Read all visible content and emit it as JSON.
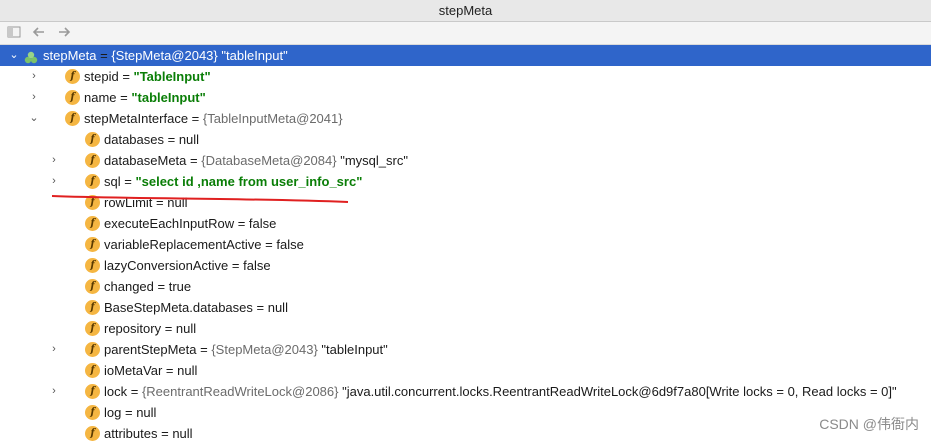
{
  "window": {
    "title": "stepMeta"
  },
  "tree": [
    {
      "arrow": "⌄",
      "icon": "obj",
      "name": "stepMeta",
      "type": "{StepMeta@2043}",
      "value": "\"tableInput\"",
      "value_style": "plain",
      "selected": true
    },
    {
      "arrow": "›",
      "icon": "f",
      "name": "stepid",
      "type": "",
      "value": "\"TableInput\"",
      "value_style": "str"
    },
    {
      "arrow": "›",
      "icon": "f",
      "name": "name",
      "type": "",
      "value": "\"tableInput\"",
      "value_style": "str"
    },
    {
      "arrow": "⌄",
      "icon": "f",
      "name": "stepMetaInterface",
      "type": "{TableInputMeta@2041}",
      "value": "",
      "value_style": "plain"
    },
    {
      "arrow": "",
      "icon": "f",
      "name": "databases",
      "type": "",
      "value": "null",
      "value_style": "plain"
    },
    {
      "arrow": "›",
      "icon": "f",
      "name": "databaseMeta",
      "type": "{DatabaseMeta@2084}",
      "value": "\"mysql_src\"",
      "value_style": "plain"
    },
    {
      "arrow": "›",
      "icon": "f",
      "name": "sql",
      "type": "",
      "value": "\"select id ,name from user_info_src\"",
      "value_style": "str"
    },
    {
      "arrow": "",
      "icon": "f",
      "name": "rowLimit",
      "type": "",
      "value": "null",
      "value_style": "plain"
    },
    {
      "arrow": "",
      "icon": "f",
      "name": "executeEachInputRow",
      "type": "",
      "value": "false",
      "value_style": "plain"
    },
    {
      "arrow": "",
      "icon": "f",
      "name": "variableReplacementActive",
      "type": "",
      "value": "false",
      "value_style": "plain"
    },
    {
      "arrow": "",
      "icon": "f",
      "name": "lazyConversionActive",
      "type": "",
      "value": "false",
      "value_style": "plain"
    },
    {
      "arrow": "",
      "icon": "f",
      "name": "changed",
      "type": "",
      "value": "true",
      "value_style": "plain"
    },
    {
      "arrow": "",
      "icon": "f",
      "name": "BaseStepMeta.databases",
      "type": "",
      "value": "null",
      "value_style": "plain"
    },
    {
      "arrow": "",
      "icon": "f",
      "name": "repository",
      "type": "",
      "value": "null",
      "value_style": "plain"
    },
    {
      "arrow": "›",
      "icon": "f",
      "name": "parentStepMeta",
      "type": "{StepMeta@2043}",
      "value": "\"tableInput\"",
      "value_style": "plain"
    },
    {
      "arrow": "",
      "icon": "f",
      "name": "ioMetaVar",
      "type": "",
      "value": "null",
      "value_style": "plain"
    },
    {
      "arrow": "›",
      "icon": "f",
      "name": "lock",
      "type": "{ReentrantReadWriteLock@2086}",
      "value": "\"java.util.concurrent.locks.ReentrantReadWriteLock@6d9f7a80[Write locks = 0, Read locks = 0]\"",
      "value_style": "plain"
    },
    {
      "arrow": "",
      "icon": "f",
      "name": "log",
      "type": "",
      "value": "null",
      "value_style": "plain"
    },
    {
      "arrow": "",
      "icon": "f",
      "name": "attributes",
      "type": "",
      "value": "null",
      "value_style": "plain"
    }
  ],
  "field_icon_glyph": "f",
  "watermark": "CSDN @伟衙内",
  "colors": {
    "selection": "#2f65ca",
    "string_value": "#0a7e07",
    "field_icon": "#f5b642",
    "annotation": "#e02020"
  }
}
